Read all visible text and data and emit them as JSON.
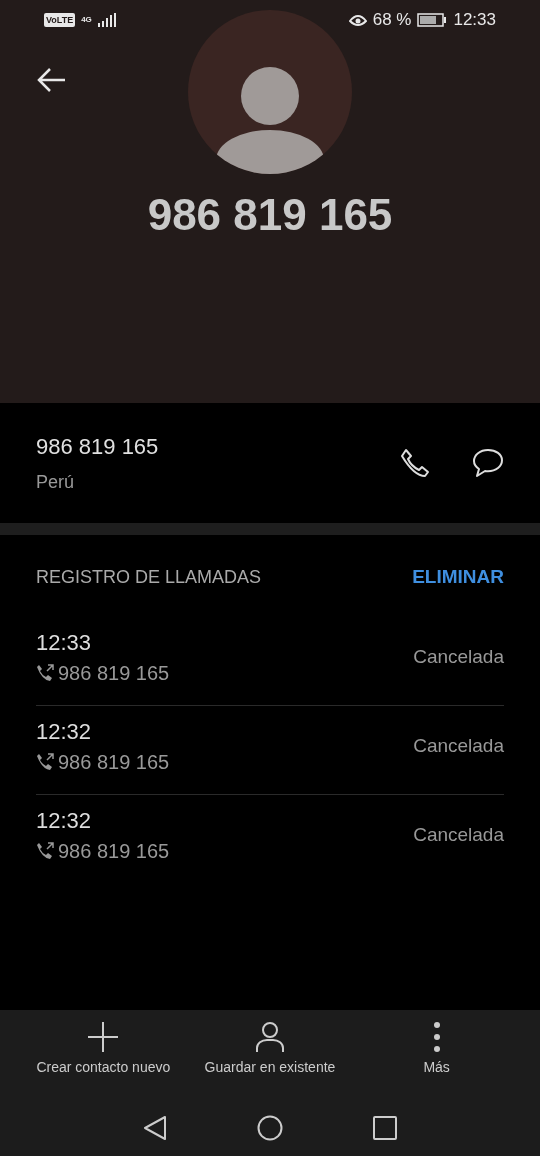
{
  "status_bar": {
    "volte": "VoLTE",
    "network": "4G",
    "battery": "68 %",
    "time": "12:33"
  },
  "contact": {
    "title": "986 819 165",
    "number": "986 819 165",
    "location": "Perú"
  },
  "call_log": {
    "title": "REGISTRO DE LLAMADAS",
    "action": "ELIMINAR",
    "rows": [
      {
        "time": "12:33",
        "number": "986 819 165",
        "status": "Cancelada"
      },
      {
        "time": "12:32",
        "number": "986 819 165",
        "status": "Cancelada"
      },
      {
        "time": "12:32",
        "number": "986 819 165",
        "status": "Cancelada"
      }
    ]
  },
  "actions": [
    {
      "kind": "add",
      "label": "Crear contacto nuevo"
    },
    {
      "kind": "person",
      "label": "Guardar en existente"
    },
    {
      "kind": "more",
      "label": "Más"
    }
  ]
}
